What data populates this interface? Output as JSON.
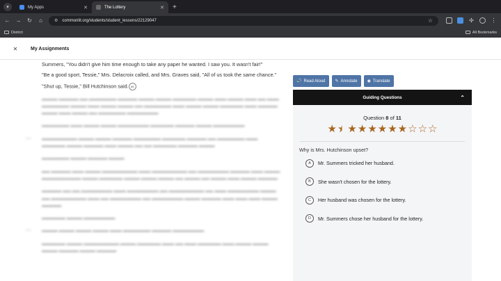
{
  "browser": {
    "tabs": [
      {
        "label": "My Apps",
        "favicon_color": "#4a8df0"
      },
      {
        "label": "The Lottery",
        "favicon_color": "#6a6a6a"
      }
    ],
    "url": "commonlit.org/students/student_lessons/22129047",
    "bookmarks": {
      "left": "District",
      "right": "All Bookmarks"
    }
  },
  "header": {
    "title": "My Assignments"
  },
  "reading": {
    "p1": "Summers, \"You didn't give him time enough to take any paper he wanted. I saw you. It wasn't fair!\"",
    "p2": "\"Be a good sport, Tessie,\" Mrs. Delacroix called, and Mrs. Graves said, \"All of us took the same chance.\"",
    "p3": "\"Shut up, Tessie,\" Bill Hutchinson said.",
    "cursor_label": "68"
  },
  "actions": {
    "read_aloud": "Read Aloud",
    "annotate": "Annotate",
    "translate": "Translate"
  },
  "guide": {
    "title": "Guiding Questions",
    "question_word": "Question",
    "question_num": "8",
    "question_of": "of",
    "question_total": "11",
    "stars_full": 7,
    "stars_half": 1,
    "stars_total": 11,
    "prompt": "Why is Mrs. Hutchinson upset?",
    "options": [
      {
        "letter": "A",
        "text": "Mr. Summers tricked her husband."
      },
      {
        "letter": "B",
        "text": "She wasn't chosen for the lottery."
      },
      {
        "letter": "C",
        "text": "Her husband was chosen for the lottery."
      },
      {
        "letter": "D",
        "text": "Mr. Summers chose her husband for the lottery."
      }
    ]
  },
  "colors": {
    "accent": "#4f74a6",
    "star": "#a8651e",
    "guide_bar": "#141414"
  }
}
